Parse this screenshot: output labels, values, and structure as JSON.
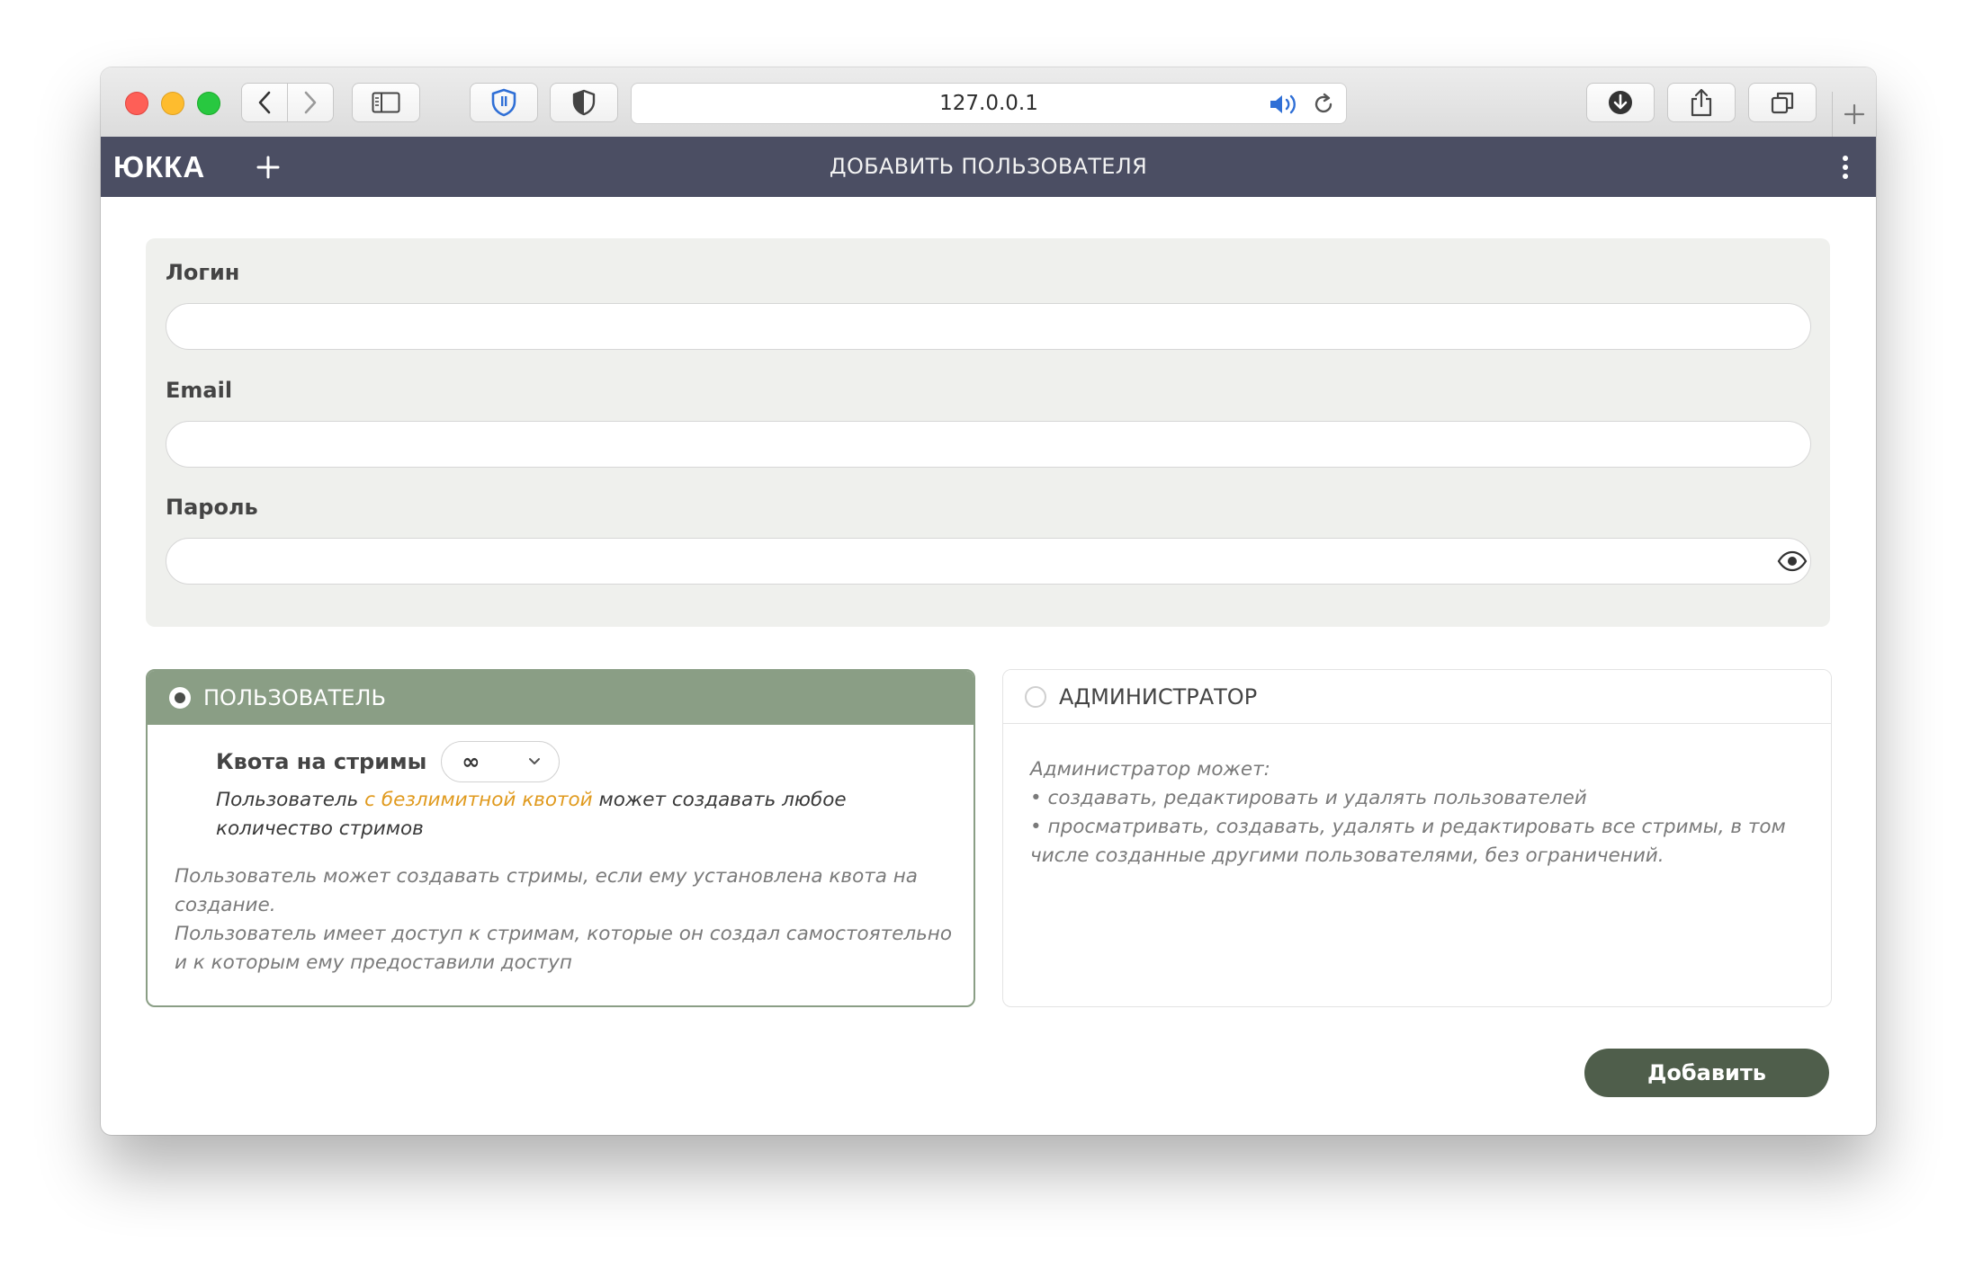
{
  "browser": {
    "url": "127.0.0.1"
  },
  "app": {
    "logo": "ЮККА",
    "title": "ДОБАВИТЬ ПОЛЬЗОВАТЕЛЯ"
  },
  "form": {
    "login_label": "Логин",
    "login_value": "",
    "email_label": "Email",
    "email_value": "",
    "password_label": "Пароль",
    "password_value": ""
  },
  "roles": {
    "user": {
      "title": "ПОЛЬЗОВАТЕЛЬ",
      "selected": true,
      "quota_label": "Квота на стримы",
      "quota_value": "∞",
      "quota_note_before": "Пользователь ",
      "quota_note_highlight": "с безлимитной квотой",
      "quota_note_after": " может создавать любое количество стримов",
      "desc_line1": "Пользователь может создавать стримы, если ему установлена квота на создание.",
      "desc_line2": "Пользователь имеет доступ к стримам, которые он создал самостоятельно и к которым ему предоставили доступ"
    },
    "admin": {
      "title": "АДМИНИСТРАТОР",
      "selected": false,
      "desc_intro": "Администратор может:",
      "desc_items": [
        "• создавать, редактировать и удалять пользователей",
        "• просматривать, создавать, удалять и редактировать все стримы, в том числе созданные другими пользователями, без ограничений."
      ]
    }
  },
  "actions": {
    "submit_label": "Добавить"
  },
  "colors": {
    "app_header": "#4b4e63",
    "role_selected": "#8a9e85",
    "submit_button": "#4f5e4b",
    "highlight": "#e09a1e"
  },
  "icons": {
    "back": "chevron-left-icon",
    "forward": "chevron-right-icon",
    "sidebar": "sidebar-icon",
    "password_manager": "shield-key-icon",
    "privacy": "half-shield-icon",
    "audio": "speaker-icon",
    "reload": "reload-icon",
    "download": "download-icon",
    "share": "share-icon",
    "tabs": "tabs-overview-icon",
    "new_tab": "plus-icon",
    "add": "plus-icon",
    "menu": "kebab-menu-icon",
    "show_password": "eye-icon"
  }
}
